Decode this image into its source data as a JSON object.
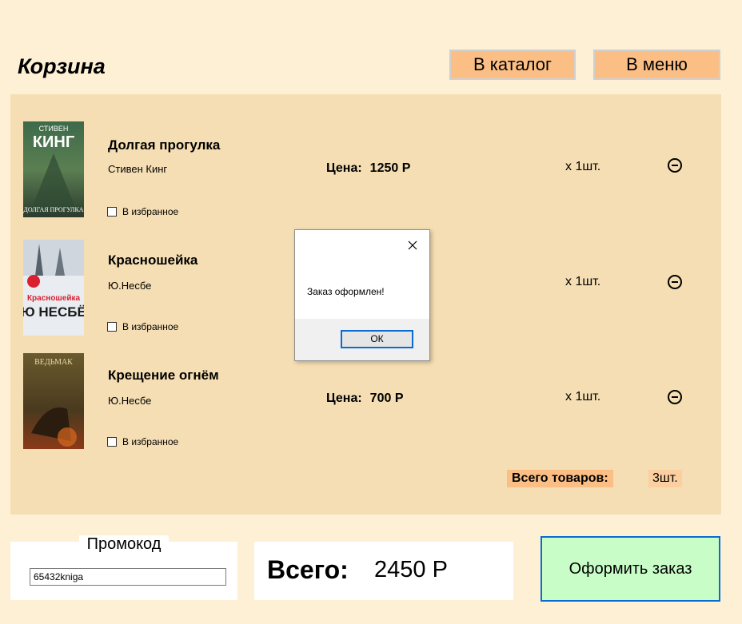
{
  "header": {
    "title": "Корзина",
    "catalog_btn": "В каталог",
    "menu_btn": "В меню"
  },
  "cart": {
    "items": [
      {
        "title": "Долгая прогулка",
        "author": "Стивен Кинг",
        "fav_label": "В избранное",
        "price_label": "Цена:",
        "price": "1250 Р",
        "qty": "x 1шт.",
        "cover_text_top": "СТИВЕН",
        "cover_text_main": "КИНГ",
        "cover_text_bottom": "ДОЛГАЯ ПРОГУЛКА"
      },
      {
        "title": "Красношейка",
        "author": "Ю.Несбе",
        "fav_label": "В избранное",
        "price_label": "",
        "price": "",
        "qty": "x 1шт.",
        "cover_text_top": "Красношейка",
        "cover_text_main": "Ю НЕСБЁ",
        "cover_text_bottom": ""
      },
      {
        "title": "Крещение огнём",
        "author": "Ю.Несбе",
        "fav_label": "В избранное",
        "price_label": "Цена:",
        "price": "700 Р",
        "qty": "x 1шт.",
        "cover_text_top": "ВЕДЬМАК",
        "cover_text_main": "",
        "cover_text_bottom": ""
      }
    ],
    "total_items_label": "Всего товаров:",
    "total_items_value": "3шт."
  },
  "promo": {
    "label": "Промокод",
    "value": "65432kniga"
  },
  "sum": {
    "label": "Всего:",
    "value": "2450 Р"
  },
  "order_btn": "Оформить заказ",
  "dialog": {
    "message": "Заказ оформлен!",
    "ok": "ОК"
  },
  "colors": {
    "background": "#fdf0d5",
    "cart_panel": "#f5deb3",
    "accent_button": "#fbbf85",
    "order_button": "#c8fdc8",
    "focus_border": "#0a6cd0"
  }
}
